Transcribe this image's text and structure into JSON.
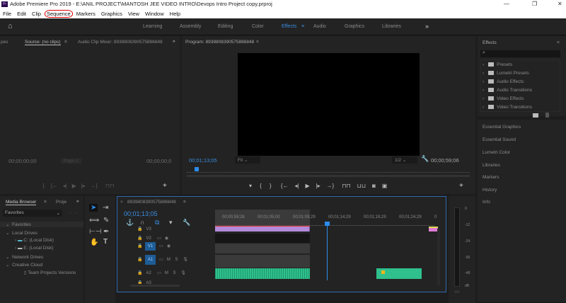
{
  "app": {
    "icon": "Pr",
    "title": "Adobe Premiere Pro 2019 - E:\\ANIL PROJECT\\MANTOSH JEE VIDEO INTRO\\Devops Intro Project copy.prproj"
  },
  "window_controls": [
    "—",
    "❐",
    "✕"
  ],
  "menu": [
    "File",
    "Edit",
    "Clip",
    "Sequence",
    "Markers",
    "Graphics",
    "View",
    "Window",
    "Help"
  ],
  "workspaces": [
    "Learning",
    "Assembly",
    "Editing",
    "Color",
    "Effects",
    "Audio",
    "Graphics",
    "Libraries"
  ],
  "active_workspace": "Effects",
  "source": {
    "tab_prev": "pes",
    "tab": "Source: (no clips)",
    "mixer": "Audio Clip Mixer: 8939808390575886848",
    "tc_left": "00;00;00;00",
    "tc_right": "00;00;00;0",
    "page": "Page 1"
  },
  "program": {
    "tab": "Program: 8939808390575886848",
    "tc_left": "00;01;13;05",
    "fit": "Fit",
    "res": "1/2",
    "tc_right": "00;00;59;06"
  },
  "effects": {
    "title": "Effects",
    "search_placeholder": "",
    "items": [
      "Presets",
      "Lumetri Presets",
      "Audio Effects",
      "Audio Transitions",
      "Video Effects",
      "Video Transitions"
    ]
  },
  "right_panels": [
    "Essential Graphics",
    "Essential Sound",
    "Lumetri Color",
    "Libraries",
    "Markers",
    "History",
    "Info"
  ],
  "media_browser": {
    "tab": "Media Browser",
    "tab2": "Proje",
    "dropdown": "Favorites",
    "tree": [
      {
        "label": "Favorites",
        "indent": 0
      },
      {
        "label": "Local Drives",
        "indent": 0
      },
      {
        "label": "C: (Local Disk)",
        "indent": 1
      },
      {
        "label": "E: (Local Disk)",
        "indent": 1
      },
      {
        "label": "Network Drives",
        "indent": 0
      },
      {
        "label": "Creative Cloud",
        "indent": 0
      },
      {
        "label": "Team Projects Versions",
        "indent": 2
      }
    ]
  },
  "timeline": {
    "name": "8939808390575886848",
    "timecode": "00;01;13;05",
    "ruler": [
      "00;00;59;28",
      "00;01;05;00",
      "00;01;09;29",
      "00;01;14;29",
      "00;01;19;29",
      "00;01;24;29",
      "0"
    ],
    "tracks": [
      {
        "id": "V3"
      },
      {
        "id": "V2"
      },
      {
        "id": "V1",
        "target": "V1"
      },
      {
        "id": "A1",
        "target": "A1"
      },
      {
        "id": "A2"
      },
      {
        "id": "A3"
      }
    ],
    "mute": "M",
    "solo": "S",
    "playhead_percent": 51
  },
  "meter": {
    "labels": [
      "0",
      "-12",
      "-24",
      "-36",
      "-48",
      "dB"
    ]
  },
  "colors": {
    "accent": "#2d8ceb",
    "video_clip": "#b38ad9",
    "audio_clip": "#2fc08d",
    "pink_clip": "#e07ad6"
  }
}
